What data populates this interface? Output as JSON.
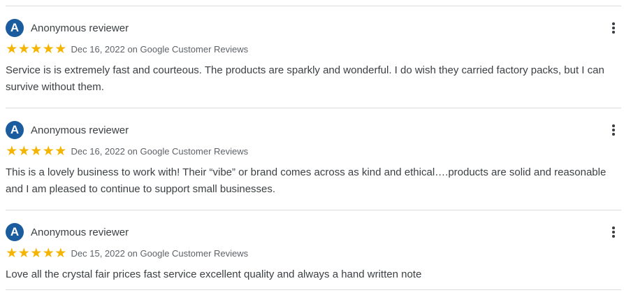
{
  "reviews": [
    {
      "avatar_letter": "A",
      "author": "Anonymous reviewer",
      "rating": 5,
      "stars": "★★★★★",
      "date_source": "Dec 16, 2022 on Google Customer Reviews",
      "text": "Service is is extremely fast and courteous. The products are sparkly and wonderful. I do wish they carried factory packs, but I can survive without them."
    },
    {
      "avatar_letter": "A",
      "author": "Anonymous reviewer",
      "rating": 5,
      "stars": "★★★★★",
      "date_source": "Dec 16, 2022 on Google Customer Reviews",
      "text": "This is a lovely business to work with! Their “vibe” or brand comes across as kind and ethical….products are solid and reasonable and I am pleased to continue to support small businesses."
    },
    {
      "avatar_letter": "A",
      "author": "Anonymous reviewer",
      "rating": 5,
      "stars": "★★★★★",
      "date_source": "Dec 15, 2022 on Google Customer Reviews",
      "text": "Love all the crystal fair prices fast service excellent quality and always a hand written note"
    }
  ],
  "colors": {
    "avatar_bg": "#1a5c9e",
    "star": "#f4b400",
    "text": "#3c4043",
    "meta_text": "#5f6368",
    "divider": "#dadce0"
  },
  "icons": {
    "more": "more-vert-icon",
    "star": "star-icon"
  }
}
